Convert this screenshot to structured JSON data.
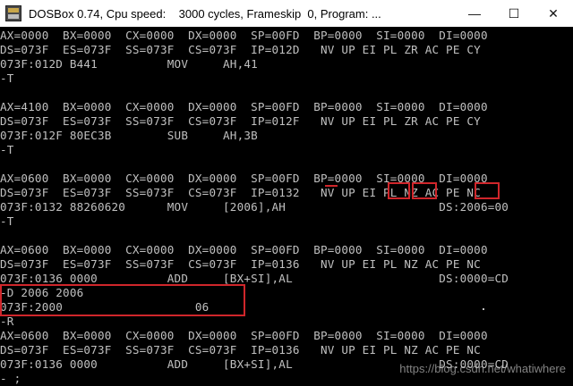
{
  "window": {
    "title": "DOSBox 0.74, Cpu speed:    3000 cycles, Frameskip  0, Program: ...",
    "minimize_glyph": "—",
    "maximize_glyph": "☐",
    "close_glyph": "✕",
    "app_icon": "dosbox-icon"
  },
  "terminal": {
    "lines": [
      "AX=0000  BX=0000  CX=0000  DX=0000  SP=00FD  BP=0000  SI=0000  DI=0000",
      "DS=073F  ES=073F  SS=073F  CS=073F  IP=012D   NV UP EI PL ZR AC PE CY",
      "073F:012D B441          MOV     AH,41",
      "-T",
      "",
      "AX=4100  BX=0000  CX=0000  DX=0000  SP=00FD  BP=0000  SI=0000  DI=0000",
      "DS=073F  ES=073F  SS=073F  CS=073F  IP=012F   NV UP EI PL ZR AC PE CY",
      "073F:012F 80EC3B        SUB     AH,3B",
      "-T",
      "",
      "AX=0600  BX=0000  CX=0000  DX=0000  SP=00FD  BP=0000  SI=0000  DI=0000",
      "DS=073F  ES=073F  SS=073F  CS=073F  IP=0132   NV UP EI PL NZ AC PE NC",
      "073F:0132 88260620      MOV     [2006],AH                      DS:2006=00",
      "-T",
      "",
      "AX=0600  BX=0000  CX=0000  DX=0000  SP=00FD  BP=0000  SI=0000  DI=0000",
      "DS=073F  ES=073F  SS=073F  CS=073F  IP=0136   NV UP EI PL NZ AC PE NC",
      "073F:0136 0000          ADD     [BX+SI],AL                     DS:0000=CD",
      "-D 2006 2006",
      "073F:2000                   06",
      "-R",
      "AX=0600  BX=0000  CX=0000  DX=0000  SP=00FD  BP=0000  SI=0000  DI=0000",
      "DS=073F  ES=073F  SS=073F  CS=073F  IP=0136   NV UP EI PL NZ AC PE NC",
      "073F:0136 0000          ADD     [BX+SI],AL                     DS:0000=CD",
      "- ;"
    ]
  },
  "watermark": "https://blog.csdn.net/whatiwhere",
  "colors": {
    "terminal_bg": "#000000",
    "terminal_text": "#c0c0c0",
    "annotation_red": "#d0262b",
    "titlebar_bg": "#ffffff"
  }
}
